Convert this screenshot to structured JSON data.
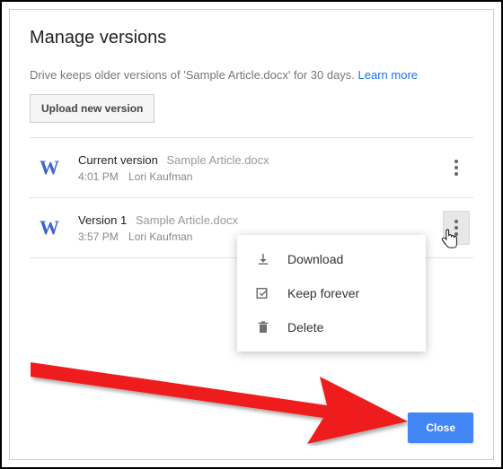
{
  "dialog": {
    "title": "Manage versions",
    "subtext_prefix": "Drive keeps older versions of 'Sample Article.docx' for 30 days. ",
    "learn_more": "Learn more",
    "upload_button": "Upload new version",
    "close_button": "Close"
  },
  "versions": [
    {
      "icon_letter": "W",
      "title": "Current version",
      "filename": "Sample Article.docx",
      "time": "4:01 PM",
      "author": "Lori Kaufman",
      "menu_open": false
    },
    {
      "icon_letter": "W",
      "title": "Version 1",
      "filename": "Sample Article.docx",
      "time": "3:57 PM",
      "author": "Lori Kaufman",
      "menu_open": true
    }
  ],
  "menu": {
    "items": [
      {
        "icon": "download",
        "label": "Download"
      },
      {
        "icon": "keep",
        "label": "Keep forever"
      },
      {
        "icon": "delete",
        "label": "Delete"
      }
    ]
  }
}
